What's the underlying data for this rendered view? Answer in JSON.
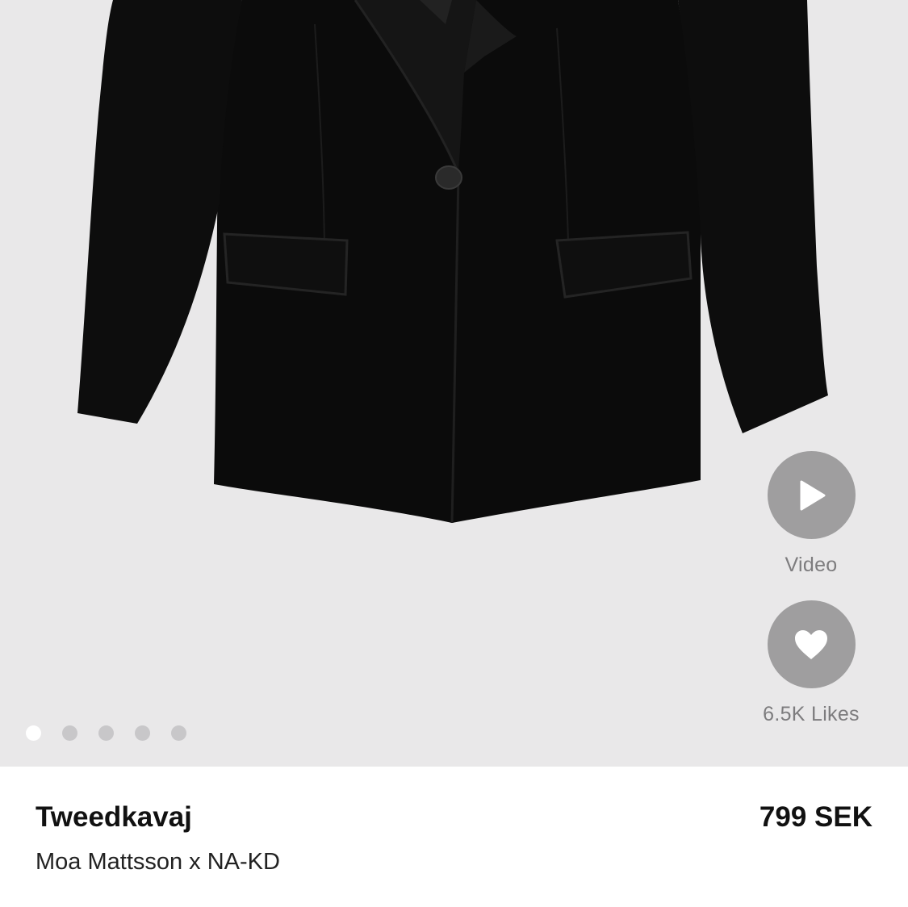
{
  "gallery": {
    "image_alt": "Black blazer",
    "dots": [
      true,
      false,
      false,
      false,
      false
    ]
  },
  "actions": {
    "video_label": "Video",
    "likes_label": "6.5K Likes"
  },
  "product": {
    "title": "Tweedkavaj",
    "price": "799 SEK",
    "brand": "Moa Mattsson x NA-KD"
  },
  "colors": {
    "background": "#e9e8e9",
    "action_circle": "#9f9e9f",
    "garment": "#0a0a0a"
  }
}
